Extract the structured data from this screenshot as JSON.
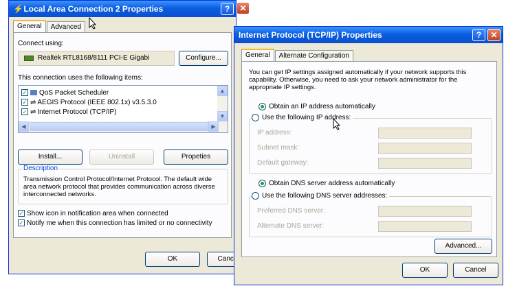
{
  "left_window": {
    "title": "Local Area Connection 2 Properties",
    "help": "?",
    "close": "✕",
    "tabs": [
      "General",
      "Advanced"
    ],
    "connect_using_label": "Connect using:",
    "adapter_name": "Realtek RTL8168/8111 PCI-E Gigabi",
    "configure_button": "Configure...",
    "items_label": "This connection uses the following items:",
    "items": [
      {
        "label": "QoS Packet Scheduler",
        "checked": true
      },
      {
        "label": "AEGIS Protocol (IEEE 802.1x) v3.5.3.0",
        "checked": true
      },
      {
        "label": "Internet Protocol (TCP/IP)",
        "checked": true
      }
    ],
    "install_button": "Install...",
    "uninstall_button": "Uninstall",
    "properties_button": "Propeties",
    "description_title": "Description",
    "description_text": "Transmission Control Protocol/Internet Protocol. The default wide area network protocol that provides communication across diverse interconnected networks.",
    "show_icon_label": "Show icon in notification area when connected",
    "notify_label": "Notify me when this connection has limited or no connectivity",
    "ok_button": "OK",
    "cancel_button": "Cance"
  },
  "right_window": {
    "title": "Internet Protocol (TCP/IP) Properties",
    "help": "?",
    "close": "✕",
    "tabs": [
      "General",
      "Alternate Configuration"
    ],
    "intro_text": "You can get IP settings assigned automatically if your network supports this capability. Otherwise, you need to ask your network administrator for the appropriate IP settings.",
    "obtain_ip_auto": "Obtain an IP address automatically",
    "use_following_ip": "Use the following IP address:",
    "ip_address_label": "IP address:",
    "subnet_mask_label": "Subnet mask:",
    "default_gateway_label": "Default gateway:",
    "obtain_dns_auto": "Obtain DNS server address automatically",
    "use_following_dns": "Use the following DNS server addresses:",
    "preferred_dns_label": "Preferred DNS server:",
    "alternate_dns_label": "Alternate DNS server:",
    "advanced_button": "Advanced...",
    "ok_button": "OK",
    "cancel_button": "Cancel"
  },
  "colors": {
    "titlebar": "#0a5fe0",
    "dialog_bg": "#ece9d8",
    "check_green": "#21a121"
  }
}
